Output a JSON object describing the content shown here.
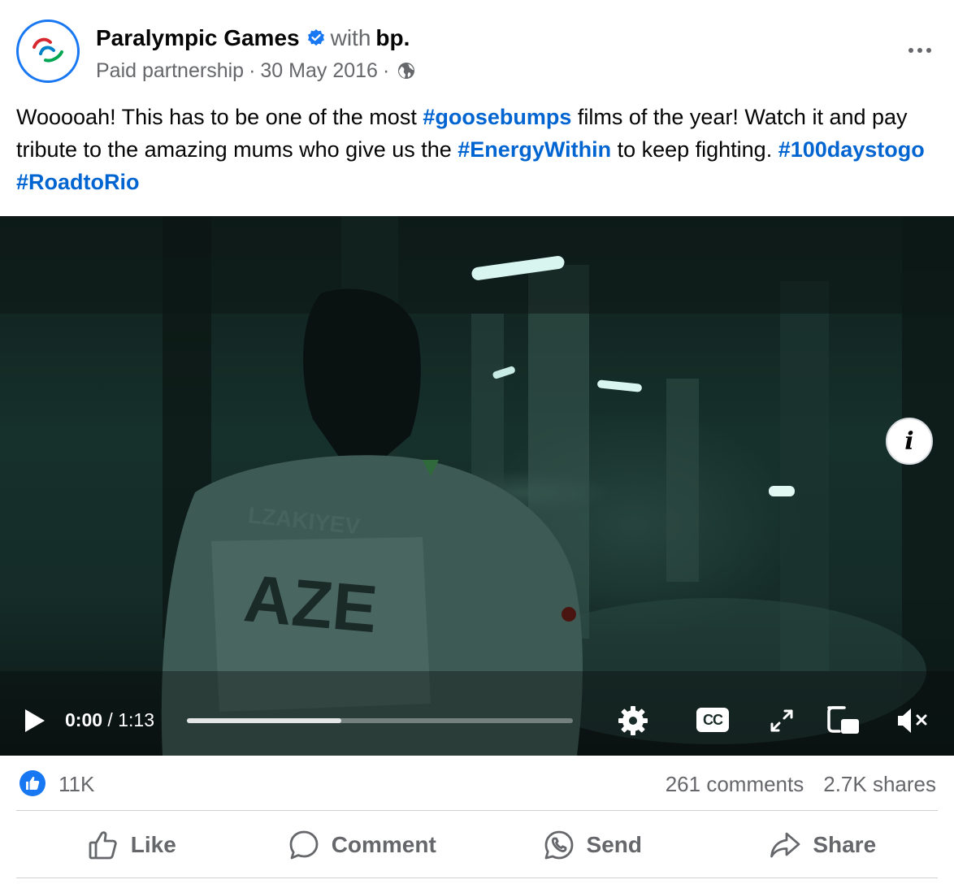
{
  "post": {
    "page_name": "Paralympic Games",
    "with_text": "with",
    "partner_name": "bp",
    "partner_suffix": ".",
    "label": "Paid partnership",
    "separator": "·",
    "date": "30 May 2016",
    "audience_icon": "globe-icon",
    "more_icon": "more-icon",
    "verified_icon": "verified-badge-icon",
    "text_parts": {
      "t1": "Wooooah! This has to be one of the most ",
      "h1": "#goosebumps",
      "t2": " films of the year! Watch it and pay tribute to the amazing mums who give us the ",
      "h2": "#EnergyWithin",
      "t3": " to keep fighting. ",
      "h3": "#100daystogo",
      "t4": " ",
      "h4": "#RoadtoRio"
    }
  },
  "video": {
    "info_label": "i",
    "current_time": "0:00",
    "time_separator": " / ",
    "duration": "1:13",
    "progress_fraction": 0.4,
    "cc_label": "CC",
    "controls": [
      "play-icon",
      "settings-gear-icon",
      "closed-captions-icon",
      "fullscreen-icon",
      "picture-in-picture-icon",
      "volume-muted-icon"
    ]
  },
  "stats": {
    "likes": "11K",
    "comments": "261 comments",
    "shares": "2.7K shares"
  },
  "actions": {
    "like": "Like",
    "comment": "Comment",
    "send": "Send",
    "share": "Share"
  },
  "colors": {
    "brand_blue": "#1877f2",
    "hashtag_blue": "#0064d1",
    "secondary_text": "#65676b",
    "divider": "#ced0d4"
  }
}
